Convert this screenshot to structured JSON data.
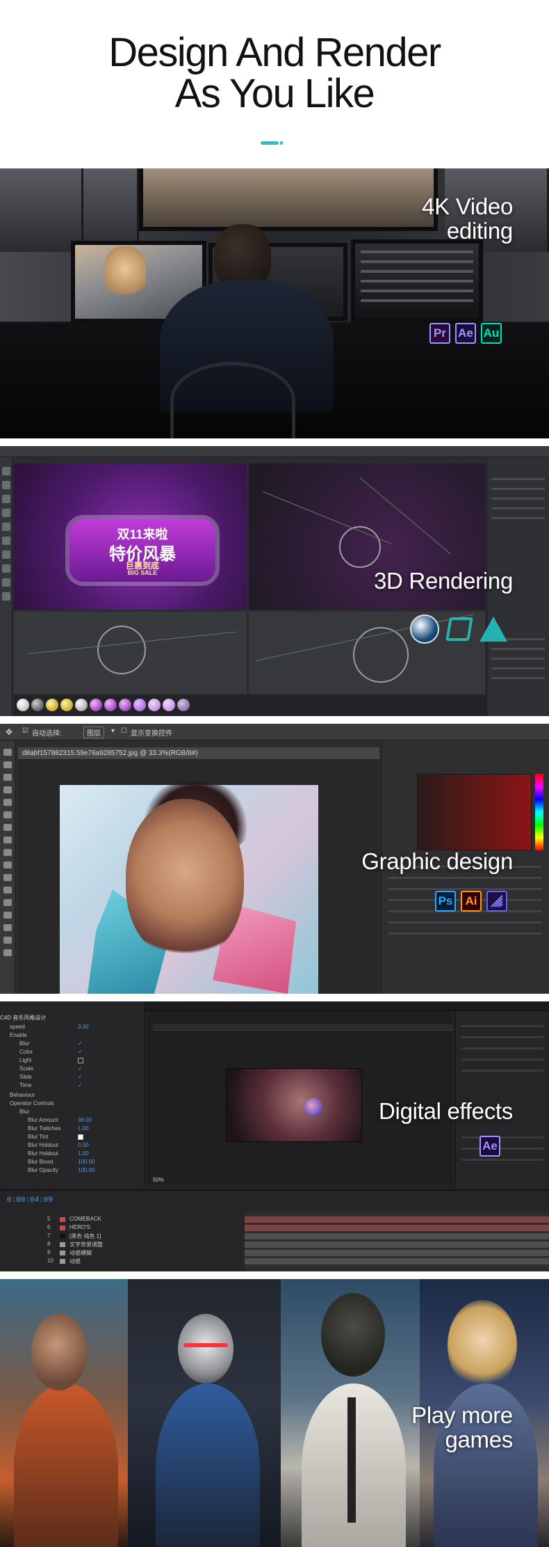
{
  "header": {
    "title_line1": "Design And Render",
    "title_line2": "As You Like",
    "accent_color": "#25c3c6"
  },
  "sections": [
    {
      "id": "video",
      "caption_line1": "4K Video",
      "caption_line2": "editing",
      "apps": [
        {
          "label": "Pr",
          "color": "#9999ff",
          "bg": "#2a0a3a"
        },
        {
          "label": "Ae",
          "color": "#9999ff",
          "bg": "#1c0a3a"
        },
        {
          "label": "Au",
          "color": "#00e4bb",
          "bg": "#00241d"
        }
      ]
    },
    {
      "id": "render3d",
      "caption_line1": "3D Rendering",
      "apps": [
        {
          "label": "cinema4d-icon"
        },
        {
          "label": "redshift-icon"
        },
        {
          "label": "arnold-icon"
        }
      ],
      "artwork_text": {
        "line1": "双11来啦",
        "line2": "特价风暴",
        "line3": "巨惠到底",
        "line4": "BIG SALE"
      }
    },
    {
      "id": "graphic",
      "caption_line1": "Graphic design",
      "apps": [
        {
          "label": "Ps",
          "color": "#31a8ff",
          "bg": "#001e36"
        },
        {
          "label": "Ai",
          "color": "#ff9a00",
          "bg": "#330000"
        },
        {
          "label": "indesign-like-icon",
          "color": "#4b3cdd",
          "bg": "#1a1240"
        }
      ],
      "ps_ui": {
        "auto_select": "自动选择:",
        "select_value": "图层",
        "show_transform": "显示变换控件",
        "doc_tab": "d8abf157882315.59e76a9285752.jpg @ 33.3%(RGB/8#)"
      }
    },
    {
      "id": "effects",
      "caption_line1": "Digital effects",
      "apps": [
        {
          "label": "Ae",
          "color": "#9999ff",
          "bg": "#1c0a3a"
        }
      ],
      "ae_ui": {
        "comp_label": "C4D 音乐风格设计",
        "props": [
          {
            "name": "speed",
            "value": "3.00"
          },
          {
            "name": "Enable",
            "value": ""
          },
          {
            "name": "Blur",
            "value": "✓"
          },
          {
            "name": "Color",
            "value": "✓"
          },
          {
            "name": "Light",
            "value": ""
          },
          {
            "name": "Scale",
            "value": "✓"
          },
          {
            "name": "Slide",
            "value": "✓"
          },
          {
            "name": "Time",
            "value": "✓"
          },
          {
            "name": "Behaviour",
            "value": ""
          },
          {
            "name": "Operator Controls",
            "value": ""
          },
          {
            "name": "Blur",
            "value": ""
          },
          {
            "name": "Blur Amount",
            "value": "36.00"
          },
          {
            "name": "Blur Twitches",
            "value": "1.00"
          },
          {
            "name": "Blur Tint",
            "value": ""
          },
          {
            "name": "Blur Holdout",
            "value": "0.00"
          },
          {
            "name": "Blur Holdout",
            "value": "1.00"
          },
          {
            "name": "Blur Boost",
            "value": "100.00"
          },
          {
            "name": "Blur Opacity",
            "value": "100.00"
          }
        ],
        "timecode": "0:00:04:09",
        "zoom": "50%",
        "layers": [
          {
            "num": "5",
            "name": "COMEBACK",
            "color": "#c94a4a"
          },
          {
            "num": "6",
            "name": "HERO'S",
            "color": "#c94a4a"
          },
          {
            "num": "7",
            "name": "[黑色 纯色 1]",
            "color": "#111111"
          },
          {
            "num": "8",
            "name": "文字背景调整",
            "color": "#9b9b9b"
          },
          {
            "num": "9",
            "name": "动感模糊",
            "color": "#9b9b9b"
          },
          {
            "num": "10",
            "name": "动感",
            "color": "#9b9b9b"
          }
        ]
      }
    },
    {
      "id": "games",
      "caption_line1": "Play more",
      "caption_line2": "games"
    }
  ]
}
